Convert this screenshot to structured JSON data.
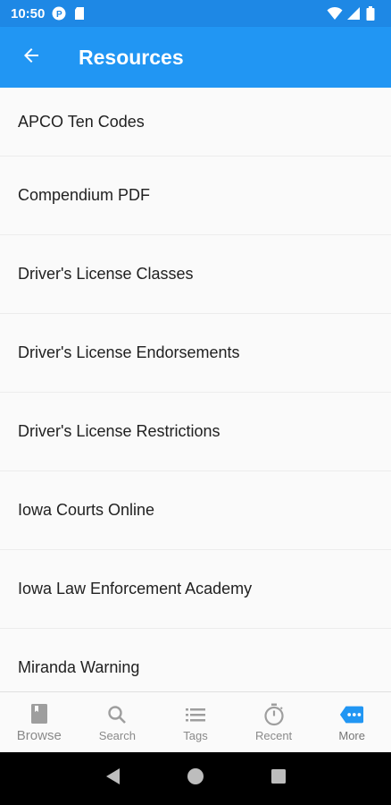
{
  "status_bar": {
    "time": "10:50"
  },
  "app_bar": {
    "title": "Resources"
  },
  "list": {
    "items": [
      {
        "label": "APCO Ten Codes"
      },
      {
        "label": "Compendium PDF"
      },
      {
        "label": "Driver's License Classes"
      },
      {
        "label": "Driver's License Endorsements"
      },
      {
        "label": "Driver's License Restrictions"
      },
      {
        "label": "Iowa Courts Online"
      },
      {
        "label": "Iowa Law Enforcement Academy"
      },
      {
        "label": "Miranda Warning"
      }
    ]
  },
  "bottom_nav": {
    "items": [
      {
        "label": "Browse",
        "icon": "book-icon"
      },
      {
        "label": "Search",
        "icon": "search-icon"
      },
      {
        "label": "Tags",
        "icon": "list-icon"
      },
      {
        "label": "Recent",
        "icon": "stopwatch-icon"
      },
      {
        "label": "More",
        "icon": "more-tag-icon",
        "active": true
      }
    ]
  },
  "colors": {
    "primary": "#2196f3",
    "status_bar": "#1e88e5",
    "accent_active": "#2196f3"
  }
}
